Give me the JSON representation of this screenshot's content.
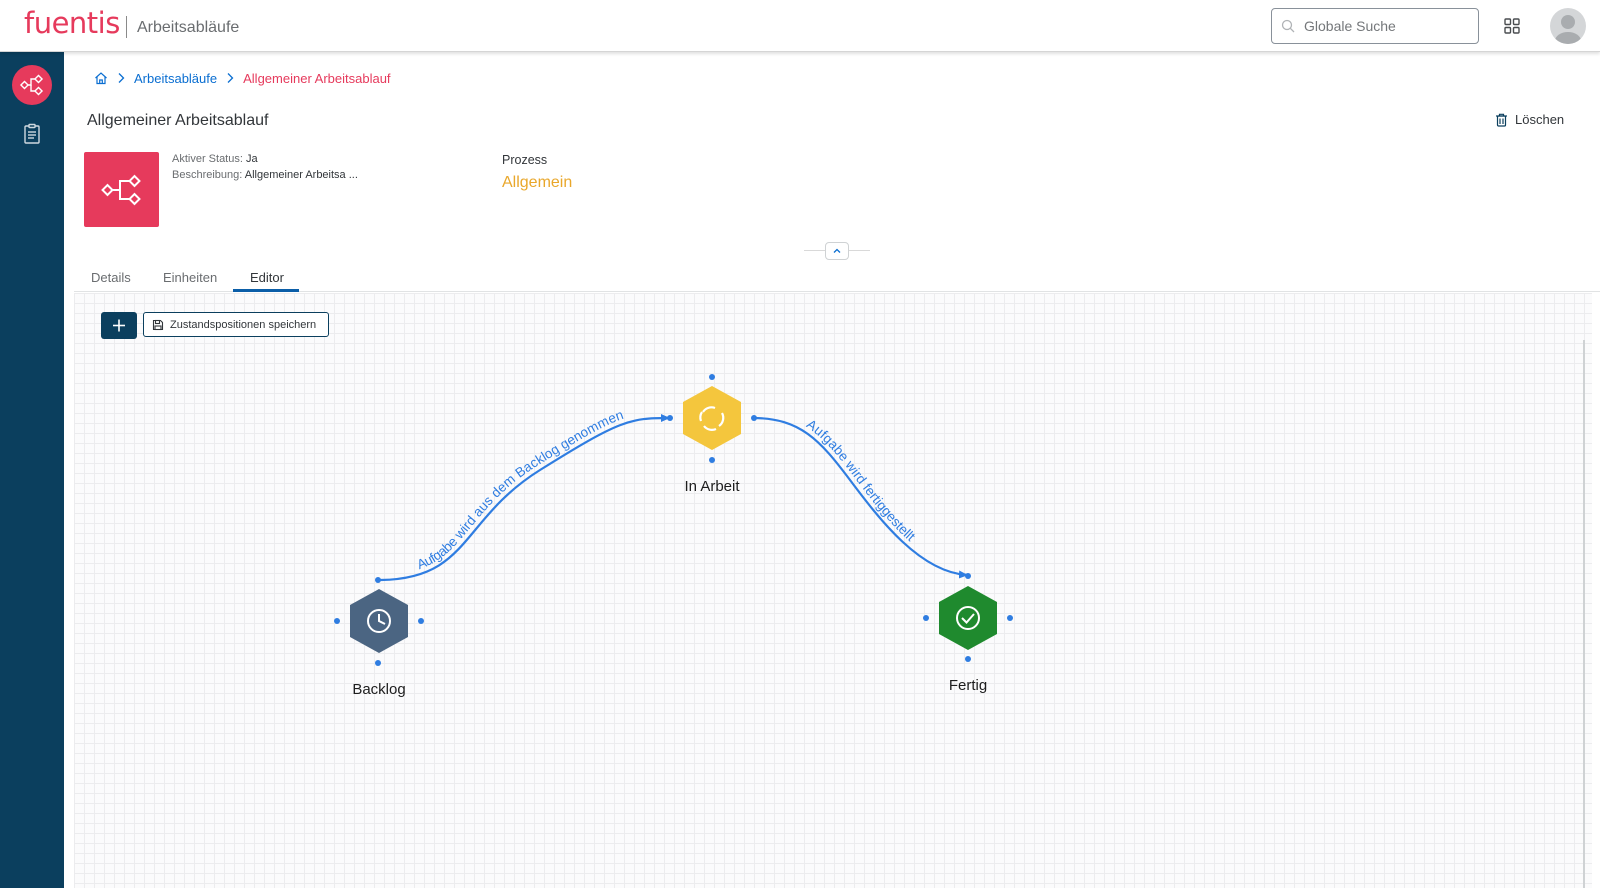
{
  "header": {
    "logo": "fuentis",
    "app_title": "Arbeitsabläufe",
    "search": {
      "placeholder": "Globale Suche",
      "value": ""
    },
    "icons": [
      "search-icon",
      "grid-icon",
      "user-avatar-icon"
    ]
  },
  "sidebar": {
    "items": [
      {
        "name": "workflow",
        "icon": "workflow-icon",
        "active": true
      },
      {
        "name": "clipboard",
        "icon": "clipboard-icon",
        "active": false
      }
    ]
  },
  "breadcrumb": {
    "home_icon": "home-icon",
    "items": [
      "Arbeitsabläufe",
      "Allgemeiner Arbeitsablauf"
    ]
  },
  "object": {
    "title": "Allgemeiner Arbeitsablauf",
    "delete_label": "Löschen",
    "icon": "workflow-icon",
    "attributes": [
      {
        "label": "Aktiver Status:",
        "value": "Ja"
      },
      {
        "label": "Beschreibung:",
        "value": "Allgemeiner Arbeitsa ..."
      }
    ],
    "process_label": "Prozess",
    "process_value": "Allgemein"
  },
  "tabs": [
    {
      "label": "Details",
      "active": false
    },
    {
      "label": "Einheiten",
      "active": false
    },
    {
      "label": "Editor",
      "active": true
    }
  ],
  "editor": {
    "add_label": "+",
    "save_label": "Zustandspositionen speichern",
    "states": [
      {
        "label": "Backlog",
        "color": "#4b6582",
        "icon": "clock-icon"
      },
      {
        "label": "In Arbeit",
        "color": "#f4c63d",
        "icon": "cycle-icon"
      },
      {
        "label": "Fertig",
        "color": "#1f8a2e",
        "icon": "check-circle-icon"
      }
    ],
    "transitions": [
      {
        "label": "Aufgabe wird aus dem Backlog genommen",
        "from": "Backlog",
        "to": "In Arbeit"
      },
      {
        "label": "Aufgabe wird fertiggestellt",
        "from": "In Arbeit",
        "to": "Fertig"
      }
    ],
    "edge_color": "#2f7de1"
  },
  "colors": {
    "brand": "#e63a5c",
    "sidebar": "#0b3f5e",
    "link": "#0a6ed1",
    "process_value": "#e9a72b"
  }
}
